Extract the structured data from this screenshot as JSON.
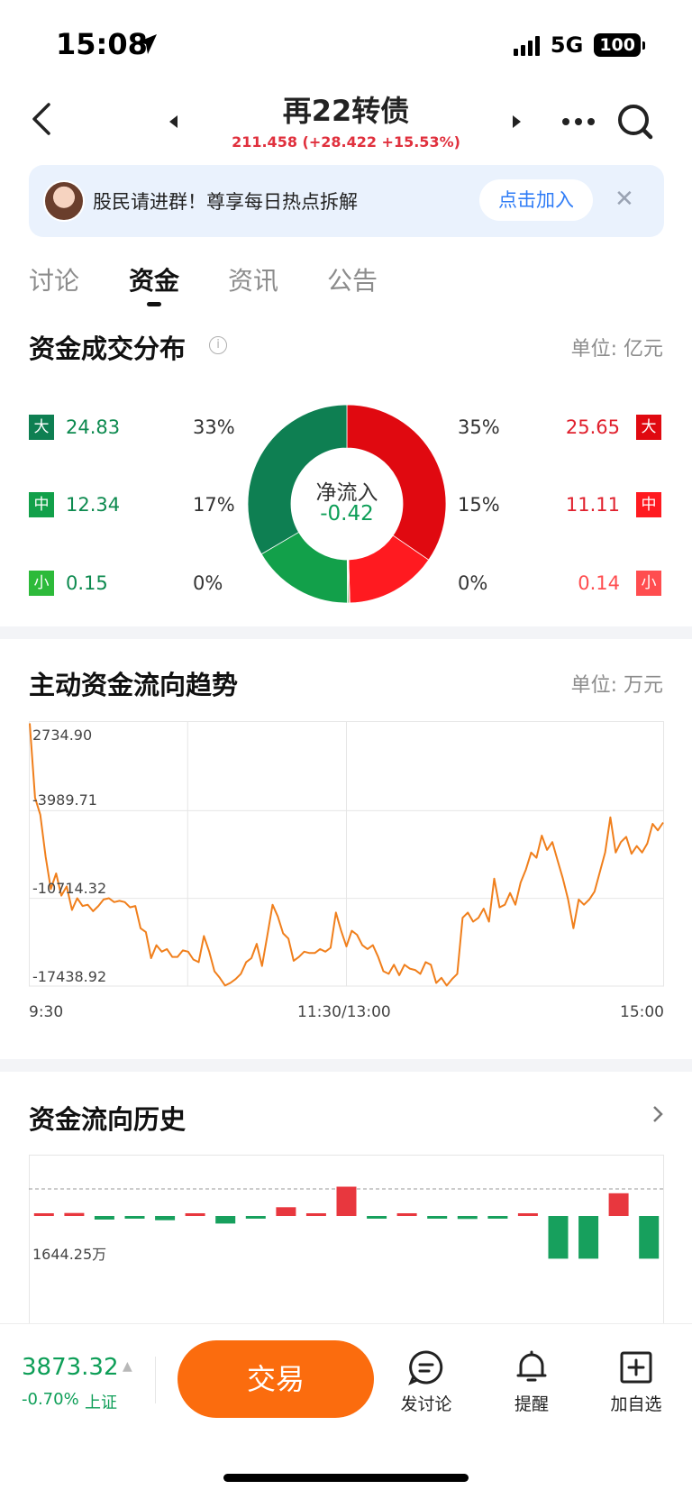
{
  "status_bar": {
    "time": "15:08",
    "network": "5G",
    "battery": "100"
  },
  "header": {
    "title": "再22转债",
    "subtitle": "211.458 (+28.422 +15.53%)"
  },
  "banner": {
    "text": "股民请进群！尊享每日热点拆解",
    "button": "点击加入"
  },
  "tabs": [
    {
      "label": "讨论"
    },
    {
      "label": "资金"
    },
    {
      "label": "资讯"
    },
    {
      "label": "公告"
    }
  ],
  "active_tab": "资金",
  "distribution": {
    "title": "资金成交分布",
    "unit": "单位: 亿元",
    "center_label": "净流入",
    "center_value": "-0.42",
    "rows": [
      {
        "size": "大",
        "out_value": "24.83",
        "out_pct": "33%",
        "in_pct": "35%",
        "in_value": "25.65"
      },
      {
        "size": "中",
        "out_value": "12.34",
        "out_pct": "17%",
        "in_pct": "15%",
        "in_value": "11.11"
      },
      {
        "size": "小",
        "out_value": "0.15",
        "out_pct": "0%",
        "in_pct": "0%",
        "in_value": "0.14"
      }
    ],
    "colors": {
      "in_large": "#e00910",
      "in_mid": "#ff1a20",
      "in_small": "#ff4d4f",
      "out_large": "#0e7f52",
      "out_mid": "#12a04a",
      "out_small": "#2dba3a"
    }
  },
  "trend": {
    "title": "主动资金流向趋势",
    "unit": "单位: 万元",
    "y_labels": [
      "2734.90",
      "-3989.71",
      "-10714.32",
      "-17438.92"
    ],
    "x_labels": [
      "9:30",
      "11:30/13:00",
      "15:00"
    ]
  },
  "history": {
    "title": "资金流向历史",
    "ref_label": "1644.25万"
  },
  "chart_data": [
    {
      "type": "pie",
      "title": "资金成交分布",
      "labels": [
        "流入 大",
        "流入 中",
        "流入 小",
        "流出 小",
        "流出 中",
        "流出 大"
      ],
      "values": [
        25.65,
        11.11,
        0.14,
        0.15,
        12.34,
        24.83
      ],
      "colors": [
        "#e00910",
        "#ff1a20",
        "#ff4d4f",
        "#2dba3a",
        "#12a04a",
        "#0e7f52"
      ]
    },
    {
      "type": "line",
      "title": "主动资金流向趋势",
      "ylim": [
        -17438.92,
        2734.9
      ],
      "y_ticks": [
        2734.9,
        -3989.71,
        -10714.32,
        -17438.92
      ],
      "x_range": [
        0,
        240
      ],
      "x_ticks": [
        {
          "x": 0,
          "label": "9:30"
        },
        {
          "x": 120,
          "label": "11:30/13:00"
        },
        {
          "x": 240,
          "label": "15:00"
        }
      ],
      "series": [
        {
          "color": "#f07f1c",
          "points": [
            [
              0,
              2700
            ],
            [
              2,
              -3000
            ],
            [
              4,
              -4300
            ],
            [
              6,
              -7500
            ],
            [
              8,
              -10000
            ],
            [
              10,
              -8800
            ],
            [
              12,
              -10500
            ],
            [
              14,
              -9800
            ],
            [
              16,
              -11600
            ],
            [
              18,
              -10700
            ],
            [
              20,
              -11300
            ],
            [
              22,
              -11200
            ],
            [
              24,
              -11700
            ],
            [
              26,
              -11300
            ],
            [
              28,
              -10800
            ],
            [
              30,
              -10700
            ],
            [
              32,
              -11000
            ],
            [
              34,
              -10900
            ],
            [
              36,
              -11000
            ],
            [
              38,
              -11400
            ],
            [
              40,
              -11300
            ],
            [
              42,
              -13000
            ],
            [
              44,
              -13300
            ],
            [
              46,
              -15300
            ],
            [
              48,
              -14300
            ],
            [
              50,
              -14800
            ],
            [
              52,
              -14600
            ],
            [
              54,
              -15200
            ],
            [
              56,
              -15200
            ],
            [
              58,
              -14700
            ],
            [
              60,
              -14800
            ],
            [
              62,
              -15400
            ],
            [
              64,
              -15600
            ],
            [
              66,
              -13600
            ],
            [
              68,
              -14800
            ],
            [
              70,
              -16300
            ],
            [
              72,
              -16800
            ],
            [
              74,
              -17400
            ],
            [
              76,
              -17200
            ],
            [
              78,
              -16900
            ],
            [
              80,
              -16500
            ],
            [
              82,
              -15600
            ],
            [
              84,
              -15300
            ],
            [
              86,
              -14200
            ],
            [
              88,
              -15900
            ],
            [
              90,
              -13600
            ],
            [
              92,
              -11200
            ],
            [
              94,
              -12100
            ],
            [
              96,
              -13400
            ],
            [
              98,
              -13800
            ],
            [
              100,
              -15500
            ],
            [
              102,
              -15200
            ],
            [
              104,
              -14800
            ],
            [
              106,
              -14900
            ],
            [
              108,
              -14900
            ],
            [
              110,
              -14600
            ],
            [
              112,
              -14800
            ],
            [
              114,
              -14500
            ],
            [
              116,
              -11800
            ],
            [
              118,
              -13200
            ],
            [
              120,
              -14400
            ],
            [
              122,
              -13200
            ],
            [
              124,
              -13500
            ],
            [
              126,
              -14300
            ],
            [
              128,
              -14600
            ],
            [
              130,
              -14300
            ],
            [
              132,
              -15200
            ],
            [
              134,
              -16300
            ],
            [
              136,
              -16500
            ],
            [
              138,
              -15800
            ],
            [
              140,
              -16600
            ],
            [
              142,
              -15800
            ],
            [
              144,
              -16100
            ],
            [
              146,
              -16200
            ],
            [
              148,
              -16500
            ],
            [
              150,
              -15600
            ],
            [
              152,
              -15800
            ],
            [
              154,
              -17200
            ],
            [
              156,
              -16800
            ],
            [
              158,
              -17400
            ],
            [
              160,
              -16900
            ],
            [
              162,
              -16500
            ],
            [
              164,
              -12200
            ],
            [
              166,
              -11800
            ],
            [
              168,
              -12500
            ],
            [
              170,
              -12200
            ],
            [
              172,
              -11500
            ],
            [
              174,
              -12500
            ],
            [
              176,
              -9200
            ],
            [
              178,
              -11400
            ],
            [
              180,
              -11200
            ],
            [
              182,
              -10300
            ],
            [
              184,
              -11200
            ],
            [
              186,
              -9500
            ],
            [
              188,
              -8500
            ],
            [
              190,
              -7200
            ],
            [
              192,
              -7600
            ],
            [
              194,
              -5900
            ],
            [
              196,
              -7000
            ],
            [
              198,
              -6400
            ],
            [
              200,
              -7800
            ],
            [
              202,
              -9200
            ],
            [
              204,
              -10800
            ],
            [
              206,
              -13000
            ],
            [
              208,
              -10800
            ],
            [
              210,
              -11200
            ],
            [
              212,
              -10800
            ],
            [
              214,
              -10200
            ],
            [
              216,
              -8700
            ],
            [
              218,
              -7200
            ],
            [
              220,
              -4500
            ],
            [
              222,
              -7200
            ],
            [
              224,
              -6400
            ],
            [
              226,
              -6000
            ],
            [
              228,
              -7300
            ],
            [
              230,
              -6700
            ],
            [
              232,
              -7200
            ],
            [
              234,
              -6500
            ],
            [
              236,
              -5000
            ],
            [
              238,
              -5500
            ],
            [
              240,
              -4900
            ]
          ]
        }
      ]
    },
    {
      "type": "bar",
      "title": "资金流向历史",
      "ref_line": 1644.25,
      "values": [
        110,
        180,
        -220,
        -150,
        -260,
        90,
        -460,
        -130,
        530,
        110,
        1780,
        -120,
        130,
        -120,
        -180,
        -90,
        140,
        -2600,
        -2600,
        1380,
        -2600
      ]
    }
  ],
  "bottom_bar": {
    "index_value": "3873.32",
    "index_change": "-0.70%",
    "index_name": "上证",
    "trade": "交易",
    "actions": [
      {
        "label": "发讨论"
      },
      {
        "label": "提醒"
      },
      {
        "label": "加自选"
      }
    ]
  }
}
